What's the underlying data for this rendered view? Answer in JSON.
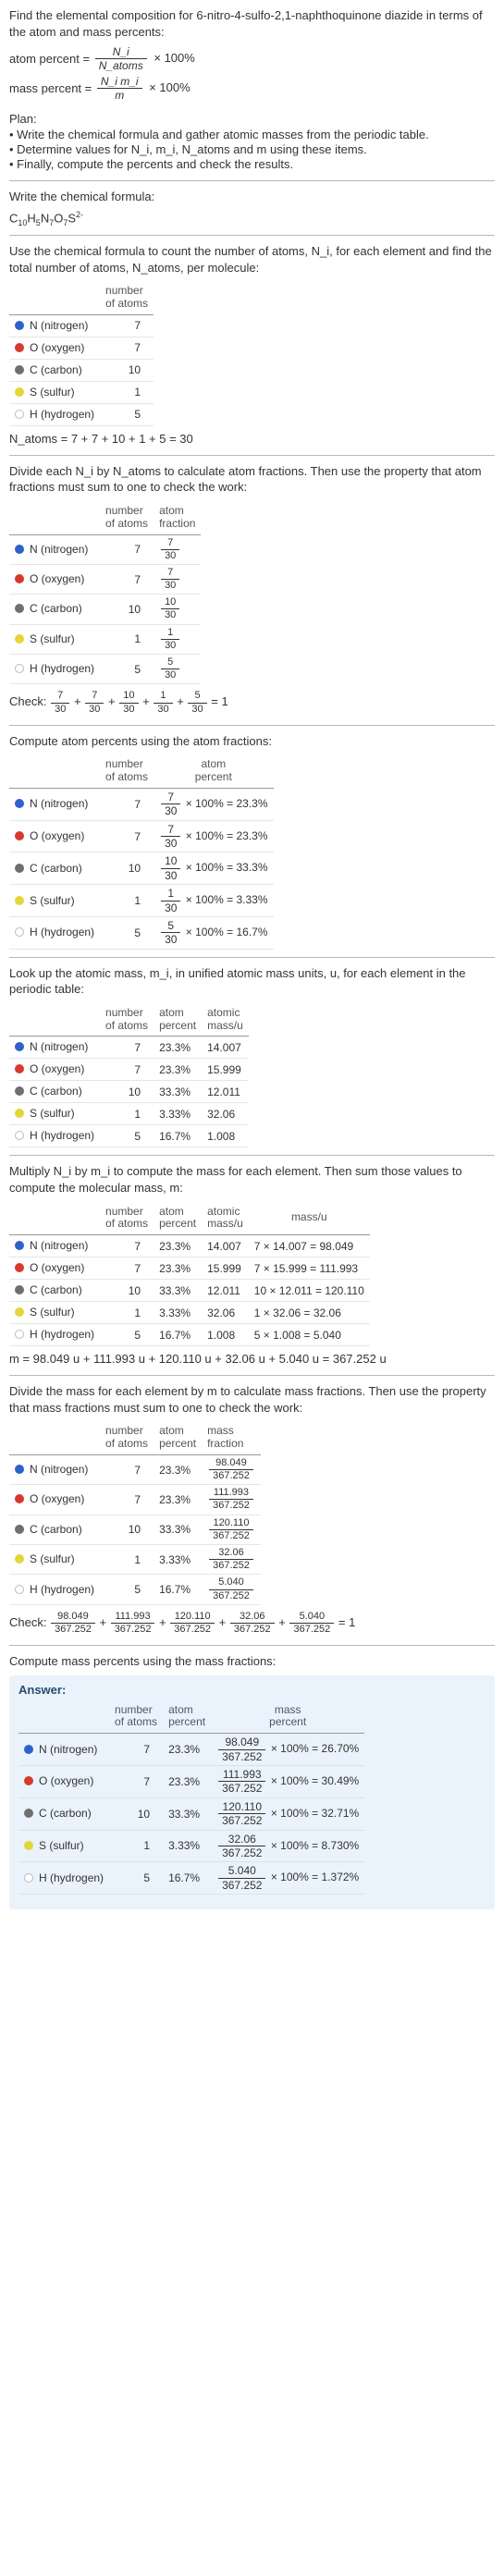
{
  "intro": "Find the elemental composition for 6-nitro-4-sulfo-2,1-naphthoquinone diazide in terms of the atom and mass percents:",
  "atom_percent_label": "atom percent =",
  "atom_percent_num": "N_i",
  "atom_percent_den": "N_atoms",
  "mass_percent_label": "mass percent =",
  "mass_percent_num": "N_i m_i",
  "mass_percent_den": "m",
  "times100": "× 100%",
  "plan_title": "Plan:",
  "plan": {
    "a": "• Write the chemical formula and gather atomic masses from the periodic table.",
    "b": "• Determine values for N_i, m_i, N_atoms and m using these items.",
    "c": "• Finally, compute the percents and check the results."
  },
  "write_formula": "Write the chemical formula:",
  "chem_formula_plain": "C10H5N7O7S",
  "chem_charge": "2-",
  "count_intro": "Use the chemical formula to count the number of atoms, N_i, for each element and find the total number of atoms, N_atoms, per molecule:",
  "headers": {
    "number_of_atoms_l1": "number",
    "number_of_atoms_l2": "of atoms",
    "atom_fraction_l1": "atom",
    "atom_fraction_l2": "fraction",
    "atom_percent_l1": "atom",
    "atom_percent_l2": "percent",
    "atomic_mass_l1": "atomic",
    "atomic_mass_l2": "mass/u",
    "mass_u": "mass/u",
    "mass_fraction_l1": "mass",
    "mass_fraction_l2": "fraction",
    "mass_percent_l1": "mass",
    "mass_percent_l2": "percent"
  },
  "elements": {
    "n": {
      "label": "N (nitrogen)",
      "count": "7"
    },
    "o": {
      "label": "O (oxygen)",
      "count": "7"
    },
    "c": {
      "label": "C (carbon)",
      "count": "10"
    },
    "s": {
      "label": "S (sulfur)",
      "count": "1"
    },
    "h": {
      "label": "H (hydrogen)",
      "count": "5"
    }
  },
  "natoms_eq": "N_atoms = 7 + 7 + 10 + 1 + 5 = 30",
  "divide_intro": "Divide each N_i by N_atoms to calculate atom fractions. Then use the property that atom fractions must sum to one to check the work:",
  "atom_fraction": {
    "n": {
      "num": "7",
      "den": "30"
    },
    "o": {
      "num": "7",
      "den": "30"
    },
    "c": {
      "num": "10",
      "den": "30"
    },
    "s": {
      "num": "1",
      "den": "30"
    },
    "h": {
      "num": "5",
      "den": "30"
    }
  },
  "check1_label": "Check:",
  "check1_eq_tail": " = 1",
  "atom_percent_intro": "Compute atom percents using the atom fractions:",
  "atom_percent": {
    "n": {
      "num": "7",
      "den": "30",
      "res": " × 100% = 23.3%"
    },
    "o": {
      "num": "7",
      "den": "30",
      "res": " × 100% = 23.3%"
    },
    "c": {
      "num": "10",
      "den": "30",
      "res": " × 100% = 33.3%"
    },
    "s": {
      "num": "1",
      "den": "30",
      "res": " × 100% = 3.33%"
    },
    "h": {
      "num": "5",
      "den": "30",
      "res": " × 100% = 16.7%"
    }
  },
  "lookup_intro": "Look up the atomic mass, m_i, in unified atomic mass units, u, for each element in the periodic table:",
  "atom_pct_short": {
    "n": "23.3%",
    "o": "23.3%",
    "c": "33.3%",
    "s": "3.33%",
    "h": "16.7%"
  },
  "atomic_mass": {
    "n": "14.007",
    "o": "15.999",
    "c": "12.011",
    "s": "32.06",
    "h": "1.008"
  },
  "mult_intro": "Multiply N_i by m_i to compute the mass for each element. Then sum those values to compute the molecular mass, m:",
  "mass_calc": {
    "n": "7 × 14.007 = 98.049",
    "o": "7 × 15.999 = 111.993",
    "c": "10 × 12.011 = 120.110",
    "s": "1 × 32.06 = 32.06",
    "h": "5 × 1.008 = 5.040"
  },
  "m_eq": "m = 98.049 u + 111.993 u + 120.110 u + 32.06 u + 5.040 u = 367.252 u",
  "mass_frac_intro": "Divide the mass for each element by m to calculate mass fractions. Then use the property that mass fractions must sum to one to check the work:",
  "mass_fraction": {
    "n": {
      "num": "98.049",
      "den": "367.252"
    },
    "o": {
      "num": "111.993",
      "den": "367.252"
    },
    "c": {
      "num": "120.110",
      "den": "367.252"
    },
    "s": {
      "num": "32.06",
      "den": "367.252"
    },
    "h": {
      "num": "5.040",
      "den": "367.252"
    }
  },
  "check2_label": "Check:",
  "check2_eq_tail": " = 1",
  "mass_percent_intro": "Compute mass percents using the mass fractions:",
  "answer_title": "Answer:",
  "mass_percent_res": {
    "n": " × 100% = 26.70%",
    "o": " × 100% = 30.49%",
    "c": " × 100% = 32.71%",
    "s": " × 100% = 8.730%",
    "h": " × 100% = 1.372%"
  },
  "plus": " + "
}
